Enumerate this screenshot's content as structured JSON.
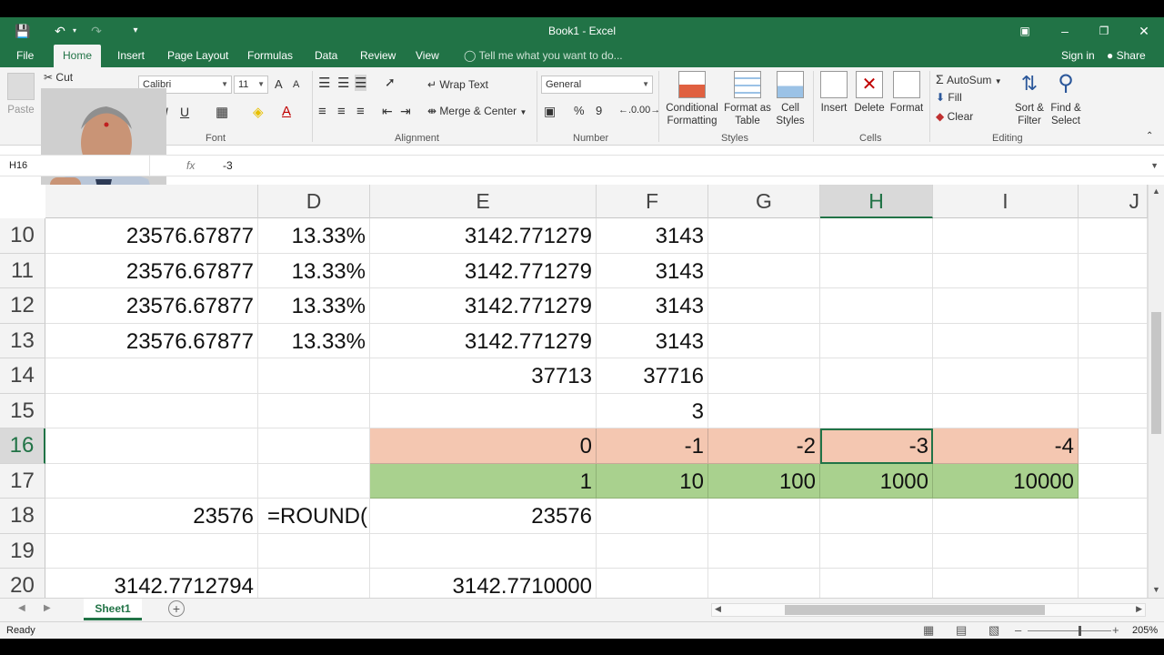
{
  "titlebar": {
    "title": "Book1 - Excel"
  },
  "tabs": [
    "File",
    "Home",
    "Insert",
    "Page Layout",
    "Formulas",
    "Data",
    "Review",
    "View"
  ],
  "tell_me": "Tell me what you want to do...",
  "sign_in": "Sign in",
  "share": "Share",
  "ribbon": {
    "clipboard": {
      "paste": "Paste",
      "cut": "Cut"
    },
    "font": {
      "name": "Calibri",
      "size": "11",
      "group": "Font",
      "underline": "U",
      "italic": "I",
      "grow": "A",
      "shrink": "A"
    },
    "alignment": {
      "wrap": "Wrap Text",
      "merge": "Merge & Center",
      "group": "Alignment"
    },
    "number": {
      "format": "General",
      "percent": "%",
      "comma": "9",
      "group": "Number"
    },
    "styles": {
      "conditional": [
        "Conditional",
        "Formatting"
      ],
      "format_table": [
        "Format as",
        "Table"
      ],
      "cell_styles": [
        "Cell",
        "Styles"
      ],
      "group": "Styles"
    },
    "cells": {
      "insert": "Insert",
      "delete": "Delete",
      "format": "Format",
      "group": "Cells"
    },
    "editing": {
      "autosum": "AutoSum",
      "fill": "Fill",
      "clear": "Clear",
      "sort": [
        "Sort &",
        "Filter"
      ],
      "find": [
        "Find &",
        "Select"
      ],
      "group": "Editing"
    }
  },
  "formula_bar": {
    "name_box": "H16",
    "fx": "fx",
    "content": "-3"
  },
  "columns": [
    "D",
    "E",
    "F",
    "G",
    "H",
    "I",
    "J"
  ],
  "rows": [
    {
      "n": "10",
      "C": "23576.67877",
      "D": "13.33%",
      "E": "3142.771279",
      "F": "3143",
      "G": "",
      "H": "",
      "I": ""
    },
    {
      "n": "11",
      "C": "23576.67877",
      "D": "13.33%",
      "E": "3142.771279",
      "F": "3143",
      "G": "",
      "H": "",
      "I": ""
    },
    {
      "n": "12",
      "C": "23576.67877",
      "D": "13.33%",
      "E": "3142.771279",
      "F": "3143",
      "G": "",
      "H": "",
      "I": ""
    },
    {
      "n": "13",
      "C": "23576.67877",
      "D": "13.33%",
      "E": "3142.771279",
      "F": "3143",
      "G": "",
      "H": "",
      "I": ""
    },
    {
      "n": "14",
      "C": "",
      "D": "",
      "E": "37713",
      "F": "37716",
      "G": "",
      "H": "",
      "I": ""
    },
    {
      "n": "15",
      "C": "",
      "D": "",
      "E": "",
      "F": "3",
      "G": "",
      "H": "",
      "I": ""
    },
    {
      "n": "16",
      "C": "",
      "D": "",
      "E": "0",
      "F": "-1",
      "G": "-2",
      "H": "-3",
      "I": "-4"
    },
    {
      "n": "17",
      "C": "",
      "D": "",
      "E": "1",
      "F": "10",
      "G": "100",
      "H": "1000",
      "I": "10000"
    },
    {
      "n": "18",
      "C": "23576",
      "D": "=ROUND(",
      "E": "23576",
      "F": "",
      "G": "",
      "H": "",
      "I": ""
    },
    {
      "n": "19",
      "C": "",
      "D": "",
      "E": "",
      "F": "",
      "G": "",
      "H": "",
      "I": ""
    },
    {
      "n": "20",
      "C": "3142.7712794",
      "D": "",
      "E": "3142.7710000",
      "F": "",
      "G": "",
      "H": "",
      "I": ""
    }
  ],
  "sheet": {
    "name": "Sheet1"
  },
  "status": {
    "ready": "Ready",
    "zoom": "205%"
  },
  "colors": {
    "accent": "#217346",
    "orange_fill": "#f4c7b1",
    "green_fill": "#a9d18e"
  }
}
